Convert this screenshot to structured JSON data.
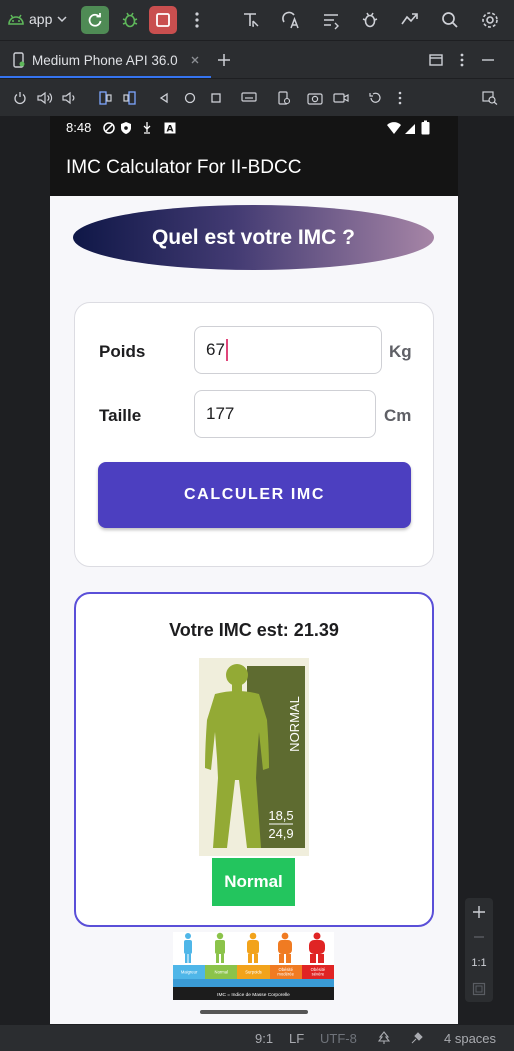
{
  "ide": {
    "run_config": "app",
    "device_tab": "Medium Phone API 36.0",
    "status": {
      "position": "9:1",
      "line_ending": "LF",
      "encoding": "UTF-8",
      "indent": "4 spaces"
    },
    "zoom_label": "1:1"
  },
  "phone": {
    "time": "8:48",
    "app_title": "IMC Calculator For II-BDCC",
    "header_pill": "Quel est votre IMC ?",
    "form": {
      "weight_label": "Poids",
      "weight_value": "67",
      "weight_unit": "Kg",
      "height_label": "Taille",
      "height_value": "177",
      "height_unit": "Cm",
      "button_label": "CALCULER IMC"
    },
    "result": {
      "text": "Votre IMC est: 21.39",
      "category_label": "Normal",
      "figure_text": "NORMAL",
      "range_low": "18,5",
      "range_high": "24,9"
    },
    "bmi_chart": {
      "categories": [
        "Maigreur",
        "Normal",
        "Surpoids",
        "Obésité modérée",
        "Obésité sévère"
      ],
      "ranges": [
        "< 18.5",
        "18.5 à 25",
        "25 à 30",
        "30 à 40",
        "> 40"
      ],
      "footer": "IMC = Indice de Masse Corporelle"
    }
  },
  "colors": {
    "ide_bg": "#2b2d30",
    "accent_blue": "#3574f0",
    "button_purple": "#4c3fc0",
    "result_border": "#5a4fd8",
    "normal_green": "#23c55e"
  }
}
